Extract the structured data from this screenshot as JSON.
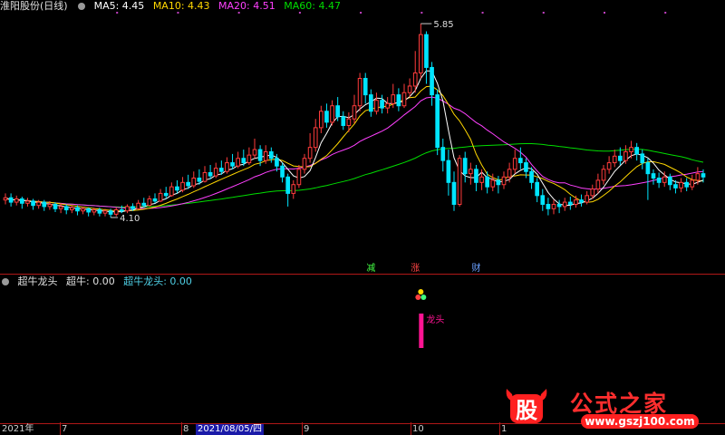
{
  "main_header": {
    "title": "淮阳股份(日线)",
    "ma5": "MA5: 4.45",
    "ma10": "MA10: 4.43",
    "ma20": "MA20: 4.51",
    "ma60": "MA60: 4.47"
  },
  "indicator_header": {
    "name": "超牛龙头",
    "chaoniu": "超牛: 0.00",
    "chaoniu_longtou": "超牛龙头: 0.00"
  },
  "chart_labels": {
    "high_label": "5.85",
    "low_label": "4.10",
    "event_1": "减",
    "event_2": "涨",
    "event_3": "财",
    "signal_label": "龙头"
  },
  "x_axis": {
    "year_label": "2021年",
    "m7": "7",
    "m8": "8",
    "selected_date": "2021/08/05/四",
    "m9": "9",
    "m10": "10",
    "m1": "1"
  },
  "watermark": {
    "logo_char": "股",
    "title": "公式之家",
    "url": "www.gszj100.com"
  },
  "colors": {
    "up": "#ff3c3c",
    "down": "#00e5ff",
    "ma5": "#ffffff",
    "ma10": "#ffd700",
    "ma20": "#ff40ff",
    "ma60": "#00dd00",
    "divider": "#b01818",
    "signal": "#ff1493"
  },
  "chart_data": {
    "type": "candlestick",
    "price_range": [
      3.6,
      5.95
    ],
    "high": 5.85,
    "low": 4.1,
    "candles": [
      [
        4.24,
        4.26,
        4.3,
        4.2
      ],
      [
        4.26,
        4.22,
        4.3,
        4.18
      ],
      [
        4.22,
        4.25,
        4.28,
        4.19
      ],
      [
        4.25,
        4.21,
        4.27,
        4.16
      ],
      [
        4.21,
        4.23,
        4.26,
        4.18
      ],
      [
        4.23,
        4.19,
        4.25,
        4.15
      ],
      [
        4.19,
        4.22,
        4.24,
        4.16
      ],
      [
        4.22,
        4.18,
        4.24,
        4.14
      ],
      [
        4.18,
        4.2,
        4.23,
        4.15
      ],
      [
        4.2,
        4.16,
        4.22,
        4.13
      ],
      [
        4.16,
        4.18,
        4.21,
        4.12
      ],
      [
        4.18,
        4.15,
        4.2,
        4.11
      ],
      [
        4.15,
        4.17,
        4.19,
        4.12
      ],
      [
        4.17,
        4.14,
        4.19,
        4.1
      ],
      [
        4.14,
        4.16,
        4.18,
        4.11
      ],
      [
        4.16,
        4.13,
        4.17,
        4.09
      ],
      [
        4.13,
        4.15,
        4.17,
        4.1
      ],
      [
        4.15,
        4.12,
        4.17,
        4.09
      ],
      [
        4.12,
        4.14,
        4.16,
        4.09
      ],
      [
        4.14,
        4.11,
        4.16,
        4.08
      ],
      [
        4.11,
        4.15,
        4.17,
        4.09
      ],
      [
        4.15,
        4.14,
        4.19,
        4.12
      ],
      [
        4.14,
        4.18,
        4.2,
        4.12
      ],
      [
        4.18,
        4.16,
        4.21,
        4.14
      ],
      [
        4.16,
        4.21,
        4.24,
        4.15
      ],
      [
        4.21,
        4.19,
        4.26,
        4.17
      ],
      [
        4.19,
        4.25,
        4.28,
        4.18
      ],
      [
        4.25,
        4.23,
        4.3,
        4.21
      ],
      [
        4.23,
        4.3,
        4.34,
        4.22
      ],
      [
        4.3,
        4.28,
        4.36,
        4.25
      ],
      [
        4.28,
        4.36,
        4.4,
        4.27
      ],
      [
        4.36,
        4.33,
        4.42,
        4.3
      ],
      [
        4.33,
        4.4,
        4.45,
        4.31
      ],
      [
        4.4,
        4.37,
        4.47,
        4.34
      ],
      [
        4.37,
        4.44,
        4.5,
        4.35
      ],
      [
        4.44,
        4.41,
        4.52,
        4.38
      ],
      [
        4.41,
        4.49,
        4.55,
        4.4
      ],
      [
        4.49,
        4.46,
        4.56,
        4.43
      ],
      [
        4.46,
        4.53,
        4.58,
        4.44
      ],
      [
        4.53,
        4.5,
        4.6,
        4.47
      ],
      [
        4.5,
        4.58,
        4.63,
        4.48
      ],
      [
        4.58,
        4.55,
        4.66,
        4.52
      ],
      [
        4.55,
        4.62,
        4.68,
        4.53
      ],
      [
        4.62,
        4.58,
        4.7,
        4.55
      ],
      [
        4.58,
        4.65,
        4.72,
        4.56
      ],
      [
        4.65,
        4.7,
        4.8,
        4.62
      ],
      [
        4.7,
        4.6,
        4.74,
        4.55
      ],
      [
        4.6,
        4.68,
        4.74,
        4.57
      ],
      [
        4.68,
        4.62,
        4.72,
        4.58
      ],
      [
        4.62,
        4.55,
        4.66,
        4.5
      ],
      [
        4.55,
        4.45,
        4.58,
        4.4
      ],
      [
        4.45,
        4.3,
        4.48,
        4.18
      ],
      [
        4.3,
        4.38,
        4.42,
        4.25
      ],
      [
        4.38,
        4.52,
        4.56,
        4.35
      ],
      [
        4.52,
        4.62,
        4.66,
        4.48
      ],
      [
        4.62,
        4.72,
        4.85,
        4.58
      ],
      [
        4.72,
        4.9,
        4.98,
        4.68
      ],
      [
        4.9,
        5.05,
        5.1,
        4.85
      ],
      [
        5.05,
        4.95,
        5.12,
        4.9
      ],
      [
        4.95,
        5.1,
        5.15,
        4.92
      ],
      [
        5.1,
        5.0,
        5.18,
        4.96
      ],
      [
        5.0,
        4.92,
        5.05,
        4.88
      ],
      [
        4.92,
        4.98,
        5.04,
        4.86
      ],
      [
        4.98,
        5.1,
        5.2,
        4.94
      ],
      [
        5.1,
        5.35,
        5.4,
        5.05
      ],
      [
        5.35,
        5.2,
        5.4,
        5.12
      ],
      [
        5.2,
        5.05,
        5.25,
        5.0
      ],
      [
        5.05,
        5.15,
        5.22,
        5.02
      ],
      [
        5.15,
        5.08,
        5.2,
        5.03
      ],
      [
        5.08,
        5.12,
        5.18,
        5.03
      ],
      [
        5.12,
        5.2,
        5.3,
        5.08
      ],
      [
        5.2,
        5.1,
        5.26,
        5.05
      ],
      [
        5.1,
        5.22,
        5.3,
        5.08
      ],
      [
        5.22,
        5.28,
        5.35,
        5.18
      ],
      [
        5.28,
        5.4,
        5.6,
        5.22
      ],
      [
        5.4,
        5.75,
        5.85,
        5.35
      ],
      [
        5.75,
        5.45,
        5.78,
        5.3
      ],
      [
        5.45,
        5.2,
        5.5,
        5.1
      ],
      [
        5.2,
        4.72,
        5.25,
        4.65
      ],
      [
        4.72,
        4.6,
        4.8,
        4.5
      ],
      [
        4.6,
        4.4,
        4.7,
        4.28
      ],
      [
        4.4,
        4.2,
        4.5,
        4.14
      ],
      [
        4.2,
        4.62,
        4.65,
        4.18
      ],
      [
        4.62,
        4.48,
        4.68,
        4.4
      ],
      [
        4.48,
        4.52,
        4.58,
        4.38
      ],
      [
        4.52,
        4.4,
        4.56,
        4.32
      ],
      [
        4.4,
        4.45,
        4.52,
        4.33
      ],
      [
        4.45,
        4.36,
        4.5,
        4.3
      ],
      [
        4.36,
        4.42,
        4.48,
        4.32
      ],
      [
        4.42,
        4.38,
        4.46,
        4.3
      ],
      [
        4.38,
        4.45,
        4.5,
        4.34
      ],
      [
        4.45,
        4.52,
        4.58,
        4.4
      ],
      [
        4.52,
        4.62,
        4.7,
        4.48
      ],
      [
        4.62,
        4.58,
        4.72,
        4.52
      ],
      [
        4.58,
        4.5,
        4.62,
        4.44
      ],
      [
        4.5,
        4.4,
        4.54,
        4.34
      ],
      [
        4.4,
        4.28,
        4.44,
        4.22
      ],
      [
        4.28,
        4.2,
        4.34,
        4.14
      ],
      [
        4.2,
        4.16,
        4.26,
        4.1
      ],
      [
        4.16,
        4.2,
        4.24,
        4.11
      ],
      [
        4.2,
        4.18,
        4.24,
        4.12
      ],
      [
        4.18,
        4.22,
        4.26,
        4.14
      ],
      [
        4.22,
        4.2,
        4.27,
        4.15
      ],
      [
        4.2,
        4.24,
        4.28,
        4.17
      ],
      [
        4.24,
        4.22,
        4.29,
        4.18
      ],
      [
        4.22,
        4.28,
        4.32,
        4.2
      ],
      [
        4.28,
        4.34,
        4.38,
        4.25
      ],
      [
        4.34,
        4.42,
        4.48,
        4.3
      ],
      [
        4.42,
        4.52,
        4.56,
        4.38
      ],
      [
        4.52,
        4.58,
        4.64,
        4.48
      ],
      [
        4.58,
        4.64,
        4.7,
        4.54
      ],
      [
        4.64,
        4.6,
        4.72,
        4.56
      ],
      [
        4.6,
        4.68,
        4.74,
        4.57
      ],
      [
        4.68,
        4.72,
        4.78,
        4.62
      ],
      [
        4.72,
        4.66,
        4.76,
        4.6
      ],
      [
        4.66,
        4.58,
        4.7,
        4.52
      ],
      [
        4.58,
        4.48,
        4.62,
        4.24
      ],
      [
        4.48,
        4.44,
        4.52,
        4.38
      ],
      [
        4.44,
        4.4,
        4.49,
        4.35
      ],
      [
        4.4,
        4.45,
        4.5,
        4.36
      ],
      [
        4.45,
        4.38,
        4.48,
        4.33
      ],
      [
        4.38,
        4.35,
        4.42,
        4.3
      ],
      [
        4.35,
        4.4,
        4.44,
        4.31
      ],
      [
        4.4,
        4.36,
        4.44,
        4.32
      ],
      [
        4.36,
        4.42,
        4.47,
        4.33
      ],
      [
        4.42,
        4.48,
        4.54,
        4.38
      ],
      [
        4.48,
        4.45,
        4.52,
        4.4
      ]
    ],
    "indicator_signal": {
      "index": 75,
      "label": "龙头"
    }
  }
}
